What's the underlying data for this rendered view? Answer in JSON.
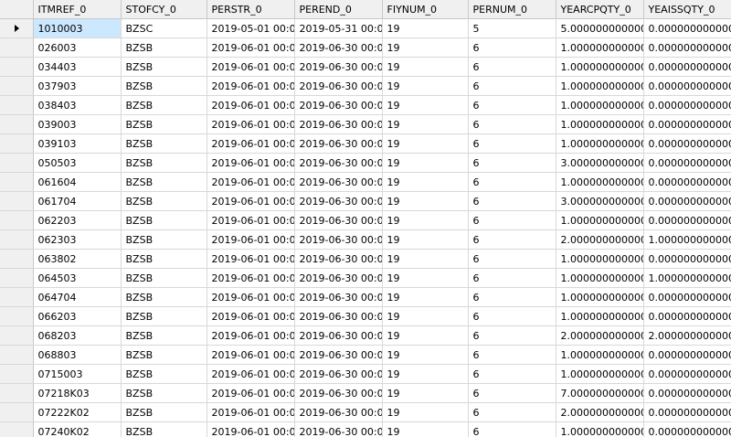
{
  "grid": {
    "columns": [
      "ITMREF_0",
      "STOFCY_0",
      "PERSTR_0",
      "PEREND_0",
      "FIYNUM_0",
      "PERNUM_0",
      "YEARCPQTY_0",
      "YEAISSQTY_0"
    ],
    "current_row_icon": "current-row-arrow-icon",
    "rows": [
      [
        "1010003",
        "BZSC",
        "2019-05-01 00:0...",
        "2019-05-31 00:0...",
        "19",
        "5",
        "5.0000000000000",
        "0.0000000000000"
      ],
      [
        "026003",
        "BZSB",
        "2019-06-01 00:0...",
        "2019-06-30 00:0...",
        "19",
        "6",
        "1.0000000000000",
        "0.0000000000000"
      ],
      [
        "034403",
        "BZSB",
        "2019-06-01 00:0...",
        "2019-06-30 00:0...",
        "19",
        "6",
        "1.0000000000000",
        "0.0000000000000"
      ],
      [
        "037903",
        "BZSB",
        "2019-06-01 00:0...",
        "2019-06-30 00:0...",
        "19",
        "6",
        "1.0000000000000",
        "0.0000000000000"
      ],
      [
        "038403",
        "BZSB",
        "2019-06-01 00:0...",
        "2019-06-30 00:0...",
        "19",
        "6",
        "1.0000000000000",
        "0.0000000000000"
      ],
      [
        "039003",
        "BZSB",
        "2019-06-01 00:0...",
        "2019-06-30 00:0...",
        "19",
        "6",
        "1.0000000000000",
        "0.0000000000000"
      ],
      [
        "039103",
        "BZSB",
        "2019-06-01 00:0...",
        "2019-06-30 00:0...",
        "19",
        "6",
        "1.0000000000000",
        "0.0000000000000"
      ],
      [
        "050503",
        "BZSB",
        "2019-06-01 00:0...",
        "2019-06-30 00:0...",
        "19",
        "6",
        "3.0000000000000",
        "0.0000000000000"
      ],
      [
        "061604",
        "BZSB",
        "2019-06-01 00:0...",
        "2019-06-30 00:0...",
        "19",
        "6",
        "1.0000000000000",
        "0.0000000000000"
      ],
      [
        "061704",
        "BZSB",
        "2019-06-01 00:0...",
        "2019-06-30 00:0...",
        "19",
        "6",
        "3.0000000000000",
        "0.0000000000000"
      ],
      [
        "062203",
        "BZSB",
        "2019-06-01 00:0...",
        "2019-06-30 00:0...",
        "19",
        "6",
        "1.0000000000000",
        "0.0000000000000"
      ],
      [
        "062303",
        "BZSB",
        "2019-06-01 00:0...",
        "2019-06-30 00:0...",
        "19",
        "6",
        "2.0000000000000",
        "1.0000000000000"
      ],
      [
        "063802",
        "BZSB",
        "2019-06-01 00:0...",
        "2019-06-30 00:0...",
        "19",
        "6",
        "1.0000000000000",
        "0.0000000000000"
      ],
      [
        "064503",
        "BZSB",
        "2019-06-01 00:0...",
        "2019-06-30 00:0...",
        "19",
        "6",
        "1.0000000000000",
        "1.0000000000000"
      ],
      [
        "064704",
        "BZSB",
        "2019-06-01 00:0...",
        "2019-06-30 00:0...",
        "19",
        "6",
        "1.0000000000000",
        "0.0000000000000"
      ],
      [
        "066203",
        "BZSB",
        "2019-06-01 00:0...",
        "2019-06-30 00:0...",
        "19",
        "6",
        "1.0000000000000",
        "0.0000000000000"
      ],
      [
        "068203",
        "BZSB",
        "2019-06-01 00:0...",
        "2019-06-30 00:0...",
        "19",
        "6",
        "2.0000000000000",
        "2.0000000000000"
      ],
      [
        "068803",
        "BZSB",
        "2019-06-01 00:0...",
        "2019-06-30 00:0...",
        "19",
        "6",
        "1.0000000000000",
        "0.0000000000000"
      ],
      [
        "0715003",
        "BZSB",
        "2019-06-01 00:0...",
        "2019-06-30 00:0...",
        "19",
        "6",
        "1.0000000000000",
        "0.0000000000000"
      ],
      [
        "07218K03",
        "BZSB",
        "2019-06-01 00:0...",
        "2019-06-30 00:0...",
        "19",
        "6",
        "7.0000000000000",
        "0.0000000000000"
      ],
      [
        "07222K02",
        "BZSB",
        "2019-06-01 00:0...",
        "2019-06-30 00:0...",
        "19",
        "6",
        "2.0000000000000",
        "0.0000000000000"
      ],
      [
        "07240K02",
        "BZSB",
        "2019-06-01 00:0...",
        "2019-06-30 00:0...",
        "19",
        "6",
        "1.0000000000000",
        "0.0000000000000"
      ]
    ]
  }
}
